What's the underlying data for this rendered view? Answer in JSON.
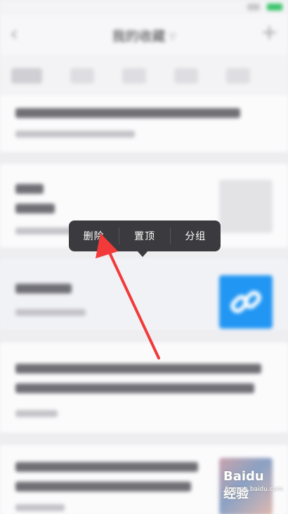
{
  "navbar": {
    "title": "我的收藏",
    "back_icon": "chevron-left-icon",
    "title_chevron_icon": "chevron-down-icon",
    "add_icon": "plus-icon"
  },
  "context_menu": {
    "items": [
      {
        "label": "删除"
      },
      {
        "label": "置顶"
      },
      {
        "label": "分组"
      }
    ]
  },
  "colors": {
    "background": "#eeeef1",
    "popup": "#3b3b3f",
    "annotation_arrow": "#f23a3a",
    "thumbnail_blue": "#2196f3"
  },
  "watermark": {
    "text": "Baidu 经验",
    "subtext": "jingyan.baidu.com"
  }
}
